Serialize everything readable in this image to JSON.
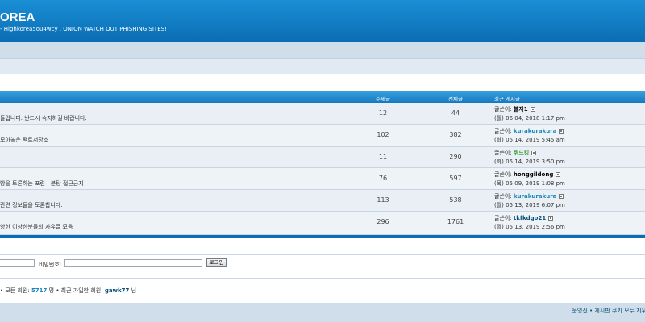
{
  "header": {
    "title": "OREA",
    "description": "- Highkorea5ou4wcy . ONION WATCH OUT PHISHING SITES!"
  },
  "table": {
    "col_topics": "주제글",
    "col_posts": "전체글",
    "col_last": "최근 게시글",
    "rows": [
      {
        "desc": "들입니다. 반드시 숙지하길 바랍니다.",
        "topics": "12",
        "posts": "44",
        "by": "글쓴이:",
        "author": "블자1",
        "date": "(월) 06 04, 2018 1:17 pm"
      },
      {
        "desc": "모아놓은 팩트저장소",
        "topics": "102",
        "posts": "382",
        "by": "글쓴이:",
        "author": "kurakurakura",
        "date": "(화) 05 14, 2019 5:45 am"
      },
      {
        "desc": "",
        "topics": "11",
        "posts": "290",
        "by": "글쓴이:",
        "author": "쥐드킹",
        "date": "(화) 05 14, 2019 3:50 pm"
      },
      {
        "desc": "방을 토론하는 포럼 | 분탕 접근금지",
        "topics": "76",
        "posts": "597",
        "by": "글쓴이:",
        "author": "honggildong",
        "date": "(목) 05 09, 2019 1:08 pm"
      },
      {
        "desc": "관련 정보들을 토론합니다.",
        "topics": "113",
        "posts": "538",
        "by": "글쓴이:",
        "author": "kurakurakura",
        "date": "(월) 05 13, 2019 6:07 pm"
      },
      {
        "desc": "양한 이상한분들의 자유글 모음",
        "topics": "296",
        "posts": "1761",
        "by": "글쓴이:",
        "author": "tkfkdgo21",
        "date": "(월) 05 13, 2019 2:56 pm"
      }
    ]
  },
  "login": {
    "password_label": "비밀번호:",
    "login_button": "로그인"
  },
  "stats": {
    "prefix": "• 모든 회원:",
    "member_count": "5717",
    "middle": "명 • 최근 가입한 회원:",
    "newest_member": "gawk77",
    "suffix": "님"
  },
  "footer": {
    "links": "운영진 • 게시판 쿠키 모두 지우"
  },
  "colors": {
    "header_blue": "#0b6db3",
    "link_teal": "#1b86b8",
    "author_green": "#2f9a2f"
  }
}
